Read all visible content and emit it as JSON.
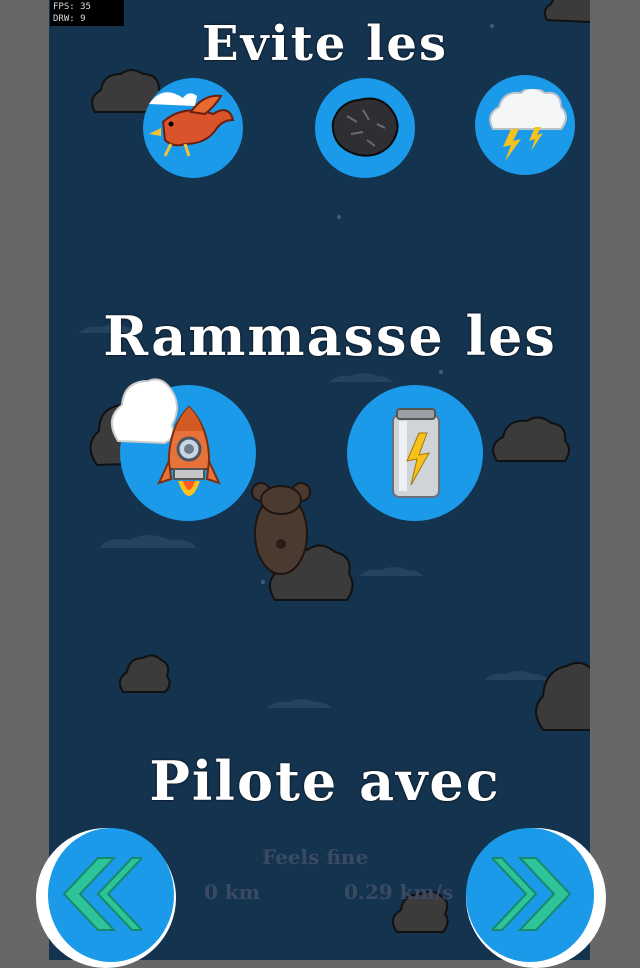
{
  "debug": {
    "fps_line": "FPS: 35",
    "drw_line": "DRW: 9"
  },
  "sections": {
    "avoid_title": "Evite les",
    "collect_title": "Rammasse les",
    "pilot_title": "Pilote avec"
  },
  "avoid_items": [
    "bird-icon",
    "rock-icon",
    "storm-cloud-icon"
  ],
  "collect_items": [
    "rocket-icon",
    "energy-can-icon"
  ],
  "hud": {
    "status": "Feels fine",
    "distance": "0 km",
    "speed": "0.29 km/s"
  },
  "controls": {
    "left": "double-chevron-left-icon",
    "right": "double-chevron-right-icon"
  },
  "colors": {
    "background": "#14334f",
    "button_blue": "#1a9ae8",
    "arrow_green": "#2ec49a",
    "side_gray": "#676767"
  }
}
